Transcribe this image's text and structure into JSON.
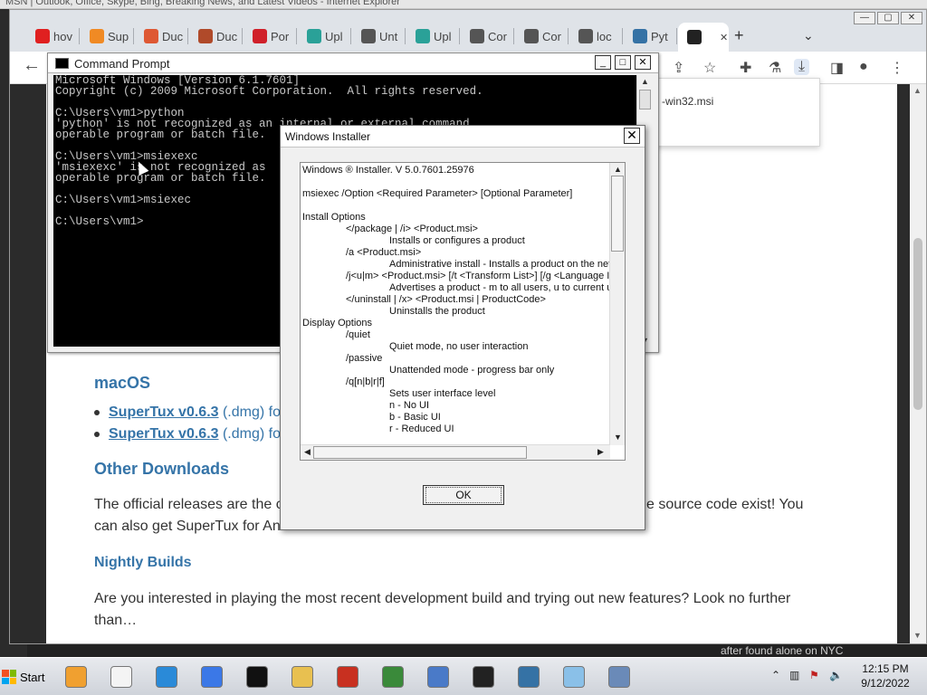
{
  "ie_title": "MSN | Outlook, Office, Skype, Bing, Breaking News, and Latest Videos - Internet Explorer",
  "chrome": {
    "tabs": [
      {
        "label": "hov",
        "icon": "youtube-icon",
        "color": "#e02020"
      },
      {
        "label": "Sup",
        "icon": "supertux-icon",
        "color": "#f08a24"
      },
      {
        "label": "Duc",
        "icon": "duckduckgo-icon",
        "color": "#de5833"
      },
      {
        "label": "Duc",
        "icon": "bucket-icon",
        "color": "#b04a2a"
      },
      {
        "label": "Por",
        "icon": "pinterest-icon",
        "color": "#d0202a"
      },
      {
        "label": "Upl",
        "icon": "upload-icon",
        "color": "#2aa198"
      },
      {
        "label": "Unt",
        "icon": "globe-icon",
        "color": "#555555"
      },
      {
        "label": "Upl",
        "icon": "upload-icon",
        "color": "#2aa198"
      },
      {
        "label": "Cor",
        "icon": "globe-icon",
        "color": "#555555"
      },
      {
        "label": "Cor",
        "icon": "globe-icon",
        "color": "#555555"
      },
      {
        "label": "loc",
        "icon": "globe-icon",
        "color": "#555555"
      },
      {
        "label": "Pyt",
        "icon": "python-icon",
        "color": "#3572a5"
      },
      {
        "label": "",
        "icon": "tux-icon",
        "color": "#222222"
      }
    ],
    "download_item": "-win32.msi"
  },
  "page": {
    "macos_heading": "macOS",
    "links": [
      {
        "bold": "SuperTux v0.6.3",
        "rest": " (.dmg) fo"
      },
      {
        "bold": "SuperTux v0.6.3",
        "rest": " (.dmg) fo"
      }
    ],
    "other_heading": "Other Downloads",
    "other_left_1": "The official releases are the c",
    "other_right_1": "e source code exist! You",
    "other_left_2": "can also get SuperTux for An",
    "nightly_heading": "Nightly Builds",
    "nightly_text_1": "Are you interested in playing the most recent development build and trying out new features? Look no further",
    "nightly_text_2": "than…",
    "preview_caption": "after found alone on NYC"
  },
  "cmd": {
    "title": "Command Prompt",
    "lines": [
      "Microsoft Windows [Version 6.1.7601]",
      "Copyright (c) 2009 Microsoft Corporation.  All rights reserved.",
      "",
      "C:\\Users\\vm1>python",
      "'python' is not recognized as an internal or external command,",
      "operable program or batch file.",
      "",
      "C:\\Users\\vm1>msiexexc",
      "'msiexexc' is not recognized as",
      "operable program or batch file.",
      "",
      "C:\\Users\\vm1>msiexec",
      "",
      "C:\\Users\\vm1>"
    ]
  },
  "installer": {
    "title": "Windows Installer",
    "ok_label": "OK",
    "lines": [
      {
        "indent": 0,
        "text": "Windows ® Installer. V 5.0.7601.25976"
      },
      {
        "indent": 0,
        "text": ""
      },
      {
        "indent": 0,
        "text": "msiexec /Option <Required Parameter> [Optional Parameter]"
      },
      {
        "indent": 0,
        "text": ""
      },
      {
        "indent": 0,
        "text": "Install Options"
      },
      {
        "indent": 1,
        "text": "</package | /i> <Product.msi>"
      },
      {
        "indent": 2,
        "text": "Installs or configures a product"
      },
      {
        "indent": 1,
        "text": "/a <Product.msi>"
      },
      {
        "indent": 2,
        "text": "Administrative install - Installs a product on the netw"
      },
      {
        "indent": 1,
        "text": "/j<u|m> <Product.msi> [/t <Transform List>] [/g <Language ID"
      },
      {
        "indent": 2,
        "text": "Advertises a product - m to all users, u to current use"
      },
      {
        "indent": 1,
        "text": "</uninstall | /x> <Product.msi | ProductCode>"
      },
      {
        "indent": 2,
        "text": "Uninstalls the product"
      },
      {
        "indent": 0,
        "text": "Display Options"
      },
      {
        "indent": 1,
        "text": "/quiet"
      },
      {
        "indent": 2,
        "text": "Quiet mode, no user interaction"
      },
      {
        "indent": 1,
        "text": "/passive"
      },
      {
        "indent": 2,
        "text": "Unattended mode - progress bar only"
      },
      {
        "indent": 1,
        "text": "/q[n|b|r|f]"
      },
      {
        "indent": 2,
        "text": "Sets user interface level"
      },
      {
        "indent": 2,
        "text": "n - No UI"
      },
      {
        "indent": 2,
        "text": "b - Basic UI"
      },
      {
        "indent": 2,
        "text": "r - Reduced UI"
      }
    ]
  },
  "taskbar": {
    "start_label": "Start",
    "items": [
      {
        "name": "media-player-icon",
        "color": "#f0a030"
      },
      {
        "name": "notepad-doc-icon",
        "color": "#f4f4f4"
      },
      {
        "name": "ie-icon",
        "color": "#2a8ad8"
      },
      {
        "name": "chrome-icon",
        "color": "#3b78e7"
      },
      {
        "name": "cmd-icon",
        "color": "#111111"
      },
      {
        "name": "explorer-folder-icon",
        "color": "#e8c050"
      },
      {
        "name": "supertux-app-icon",
        "color": "#c83020"
      },
      {
        "name": "system-monitor-icon",
        "color": "#3a8a3a"
      },
      {
        "name": "installer-icon",
        "color": "#4a7ac8"
      },
      {
        "name": "7zip-icon",
        "color": "#222222"
      },
      {
        "name": "python-app-icon",
        "color": "#3572a5"
      },
      {
        "name": "notepad-icon",
        "color": "#8ac0e8"
      },
      {
        "name": "windows-installer-icon",
        "color": "#6a8ab8"
      }
    ],
    "time": "12:15 PM",
    "date": "9/12/2022"
  }
}
